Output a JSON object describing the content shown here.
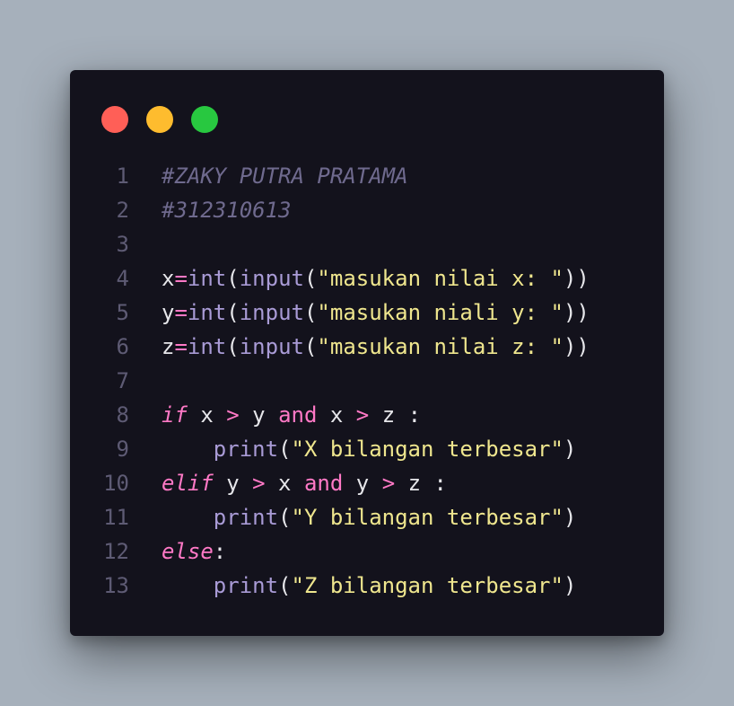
{
  "window": {
    "dots": [
      {
        "name": "close",
        "color": "#ff5f57"
      },
      {
        "name": "minimize",
        "color": "#febc2e"
      },
      {
        "name": "maximize",
        "color": "#28c840"
      }
    ]
  },
  "colors": {
    "background": "#a6b0bb",
    "editor": "#13121c",
    "comment": "#6f6a8e",
    "keyword": "#ff79c6",
    "function": "#a99bd6",
    "string": "#efe68e",
    "text": "#e6e6ea",
    "line_number": "#5e5b74"
  },
  "code_lines": [
    {
      "number": "1",
      "tokens": [
        {
          "t": "comment",
          "v": "#ZAKY PUTRA PRATAMA"
        }
      ]
    },
    {
      "number": "2",
      "tokens": [
        {
          "t": "comment",
          "v": "#312310613"
        }
      ]
    },
    {
      "number": "3",
      "tokens": []
    },
    {
      "number": "4",
      "tokens": [
        {
          "t": "var",
          "v": "x"
        },
        {
          "t": "op",
          "v": "="
        },
        {
          "t": "fn",
          "v": "int"
        },
        {
          "t": "paren",
          "v": "("
        },
        {
          "t": "fn",
          "v": "input"
        },
        {
          "t": "paren",
          "v": "("
        },
        {
          "t": "str",
          "v": "\"masukan nilai x: \""
        },
        {
          "t": "paren",
          "v": "))"
        }
      ]
    },
    {
      "number": "5",
      "tokens": [
        {
          "t": "var",
          "v": "y"
        },
        {
          "t": "op",
          "v": "="
        },
        {
          "t": "fn",
          "v": "int"
        },
        {
          "t": "paren",
          "v": "("
        },
        {
          "t": "fn",
          "v": "input"
        },
        {
          "t": "paren",
          "v": "("
        },
        {
          "t": "str",
          "v": "\"masukan niali y: \""
        },
        {
          "t": "paren",
          "v": "))"
        }
      ]
    },
    {
      "number": "6",
      "tokens": [
        {
          "t": "var",
          "v": "z"
        },
        {
          "t": "op",
          "v": "="
        },
        {
          "t": "fn",
          "v": "int"
        },
        {
          "t": "paren",
          "v": "("
        },
        {
          "t": "fn",
          "v": "input"
        },
        {
          "t": "paren",
          "v": "("
        },
        {
          "t": "str",
          "v": "\"masukan nilai z: \""
        },
        {
          "t": "paren",
          "v": "))"
        }
      ]
    },
    {
      "number": "7",
      "tokens": []
    },
    {
      "number": "8",
      "tokens": [
        {
          "t": "kw",
          "v": "if"
        },
        {
          "t": "var",
          "v": " x "
        },
        {
          "t": "op",
          "v": ">"
        },
        {
          "t": "var",
          "v": " y "
        },
        {
          "t": "kwb",
          "v": "and"
        },
        {
          "t": "var",
          "v": " x "
        },
        {
          "t": "op",
          "v": ">"
        },
        {
          "t": "var",
          "v": " z "
        },
        {
          "t": "punct",
          "v": ":"
        }
      ]
    },
    {
      "number": "9",
      "tokens": [
        {
          "t": "var",
          "v": "    "
        },
        {
          "t": "fn",
          "v": "print"
        },
        {
          "t": "paren",
          "v": "("
        },
        {
          "t": "str",
          "v": "\"X bilangan terbesar\""
        },
        {
          "t": "paren",
          "v": ")"
        }
      ]
    },
    {
      "number": "10",
      "tokens": [
        {
          "t": "kw",
          "v": "elif"
        },
        {
          "t": "var",
          "v": " y "
        },
        {
          "t": "op",
          "v": ">"
        },
        {
          "t": "var",
          "v": " x "
        },
        {
          "t": "kwb",
          "v": "and"
        },
        {
          "t": "var",
          "v": " y "
        },
        {
          "t": "op",
          "v": ">"
        },
        {
          "t": "var",
          "v": " z "
        },
        {
          "t": "punct",
          "v": ":"
        }
      ]
    },
    {
      "number": "11",
      "tokens": [
        {
          "t": "var",
          "v": "    "
        },
        {
          "t": "fn",
          "v": "print"
        },
        {
          "t": "paren",
          "v": "("
        },
        {
          "t": "str",
          "v": "\"Y bilangan terbesar\""
        },
        {
          "t": "paren",
          "v": ")"
        }
      ]
    },
    {
      "number": "12",
      "tokens": [
        {
          "t": "kw",
          "v": "else"
        },
        {
          "t": "punct",
          "v": ":"
        }
      ]
    },
    {
      "number": "13",
      "tokens": [
        {
          "t": "var",
          "v": "    "
        },
        {
          "t": "fn",
          "v": "print"
        },
        {
          "t": "paren",
          "v": "("
        },
        {
          "t": "str",
          "v": "\"Z bilangan terbesar\""
        },
        {
          "t": "paren",
          "v": ")"
        }
      ]
    }
  ]
}
